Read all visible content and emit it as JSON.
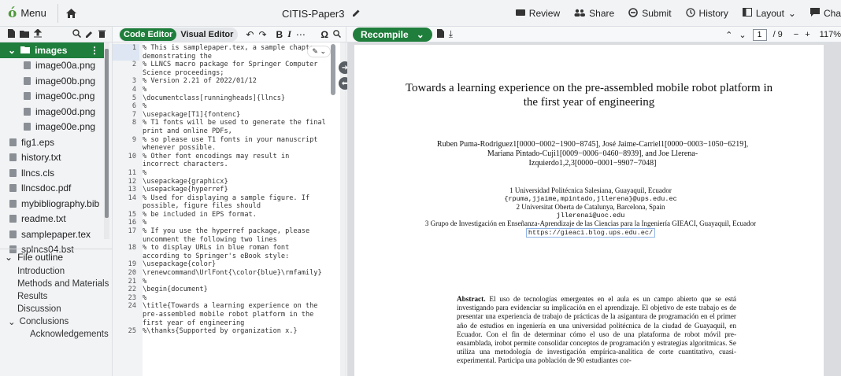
{
  "topbar": {
    "menu_label": "Menu",
    "logo": "ó",
    "project_title": "CITIS-Paper3",
    "buttons": [
      {
        "icon": "video-icon",
        "label": "Review"
      },
      {
        "icon": "users-icon",
        "label": "Share"
      },
      {
        "icon": "submit-icon",
        "label": "Submit"
      },
      {
        "icon": "history-icon",
        "label": "History"
      },
      {
        "icon": "layout-icon",
        "label": "Layout"
      },
      {
        "icon": "chat-icon",
        "label": "Cha"
      }
    ]
  },
  "editor_toolbar": {
    "code_editor": "Code Editor",
    "visual_editor": "Visual Editor"
  },
  "pdf_toolbar": {
    "recompile": "Recompile",
    "page_current": "1",
    "page_total": "/ 9",
    "zoom": "117%"
  },
  "filetree": {
    "folder": "images",
    "images": [
      "image00a.png",
      "image00b.png",
      "image00c.png",
      "image00d.png",
      "image00e.png"
    ],
    "files": [
      "fig1.eps",
      "history.txt",
      "llncs.cls",
      "llncsdoc.pdf",
      "mybibliography.bib",
      "readme.txt",
      "samplepaper.tex",
      "splncs04.bst"
    ]
  },
  "outline": {
    "header": "File outline",
    "items": [
      "Introduction",
      "Methods and Materials",
      "Results",
      "Discussion",
      "Conclusions",
      "Acknowledgements"
    ]
  },
  "editor": {
    "lines": [
      {
        "n": "1",
        "t": "% This is samplepaper.tex, a sample chapter demonstrating the",
        "c": "cm"
      },
      {
        "n": "",
        "t": "demonstrating the",
        "c": "cm",
        "skip": true
      },
      {
        "n": "2",
        "t": "% LLNCS macro package for Springer Computer Science proceedings;",
        "c": "cm"
      },
      {
        "n": "3",
        "t": "% Version 2.21 of 2022/01/12",
        "c": "cm"
      },
      {
        "n": "4",
        "t": "%",
        "c": "cm"
      },
      {
        "n": "5",
        "t": "\\documentclass[runningheads]{llncs}",
        "c": "kw"
      },
      {
        "n": "6",
        "t": "%",
        "c": "cm"
      },
      {
        "n": "7",
        "t": "\\usepackage[T1]{fontenc}",
        "c": "kw"
      },
      {
        "n": "8",
        "t": "% T1 fonts will be used to generate the final print and online PDFs,",
        "c": "cm"
      },
      {
        "n": "9",
        "t": "% so please use T1 fonts in your manuscript whenever possible.",
        "c": "cm"
      },
      {
        "n": "10",
        "t": "% Other font encodings may result in incorrect characters.",
        "c": "cm"
      },
      {
        "n": "11",
        "t": "%",
        "c": "cm"
      },
      {
        "n": "12",
        "t": "\\usepackage{graphicx}",
        "c": "kw"
      },
      {
        "n": "13",
        "t": "\\usepackage{hyperref}",
        "c": "kw"
      },
      {
        "n": "14",
        "t": "% Used for displaying a sample figure. If possible, figure files should",
        "c": "cm"
      },
      {
        "n": "15",
        "t": "% be included in EPS format.",
        "c": "cm"
      },
      {
        "n": "16",
        "t": "%",
        "c": "cm"
      },
      {
        "n": "17",
        "t": "% If you use the hyperref package, please uncomment the following two lines",
        "c": "cm"
      },
      {
        "n": "18",
        "t": "% to display URLs in blue roman font according to Springer's eBook style:",
        "c": "cm"
      },
      {
        "n": "19",
        "t": "\\usepackage{color}",
        "c": "kw"
      },
      {
        "n": "20",
        "t": "\\renewcommand\\UrlFont{\\color{blue}\\rmfamily}",
        "c": "kw"
      },
      {
        "n": "21",
        "t": "%",
        "c": "cm"
      },
      {
        "n": "22",
        "t": "\\begin{document}",
        "c": "kw"
      },
      {
        "n": "23",
        "t": "%",
        "c": "cm"
      },
      {
        "n": "24",
        "t": "\\title{Towards a learning experience on the pre-assembled mobile robot platform in the first year of engineering",
        "c": "kw"
      },
      {
        "n": "25",
        "t": "%\\thanks{Supported by organization x.}",
        "c": "cm"
      }
    ]
  },
  "pdf": {
    "title": "Towards a learning experience on the pre-assembled mobile robot platform in the first year of engineering",
    "authors": "Ruben Puma-Rodriguez1[0000−0002−1900−8745], José Jaime-Carriel1[0000−0003−1050−6219], Mariana Pintado-Cuji1[0009−0006−0460−8939], and Joe Llerena-Izquierdo1,2,3[0000−0001−9907−7048]",
    "affil1": "1 Universidad Politécnica Salesiana, Guayaquil, Ecuador",
    "affil1_mail": "{rpuma,jjaime,mpintado,jllerena}@ups.edu.ec",
    "affil2": "2 Universitat Oberta de Catalunya, Barcelona, Spain",
    "affil2_mail": "jllerenai@uoc.edu",
    "affil3": "3 Grupo de Investigación en Enseñanza-Aprendizaje de las Ciencias para la Ingeniería GIEACI, Guayaquil, Ecuador",
    "url": "https://gieaci.blog.ups.edu.ec/",
    "abstract_label": "Abstract.",
    "abstract_text": "El uso de tecnologías emergentes en el aula es un campo abierto que se está investigando para evidenciar su implicación en el aprendizaje. El objetivo de este trabajo es de presentar una experiencia de trabajo de prácticas de la asigantura de programación en el primer año de estudios en ingeniería en una universidad politécnica de la ciudad de Guayaquil, en Ecuador. Con el fin de determinar cómo el uso de una plataforma de robot móvil pre-ensamblada, irobot permite consolidar conceptos de programación y estrategias algorítmicas. Se utiliza una metodología de investigación empírica-analítica de corte cuantitativo, cuasi-experimental. Participa una población de 90 estudiantes cor-"
  }
}
